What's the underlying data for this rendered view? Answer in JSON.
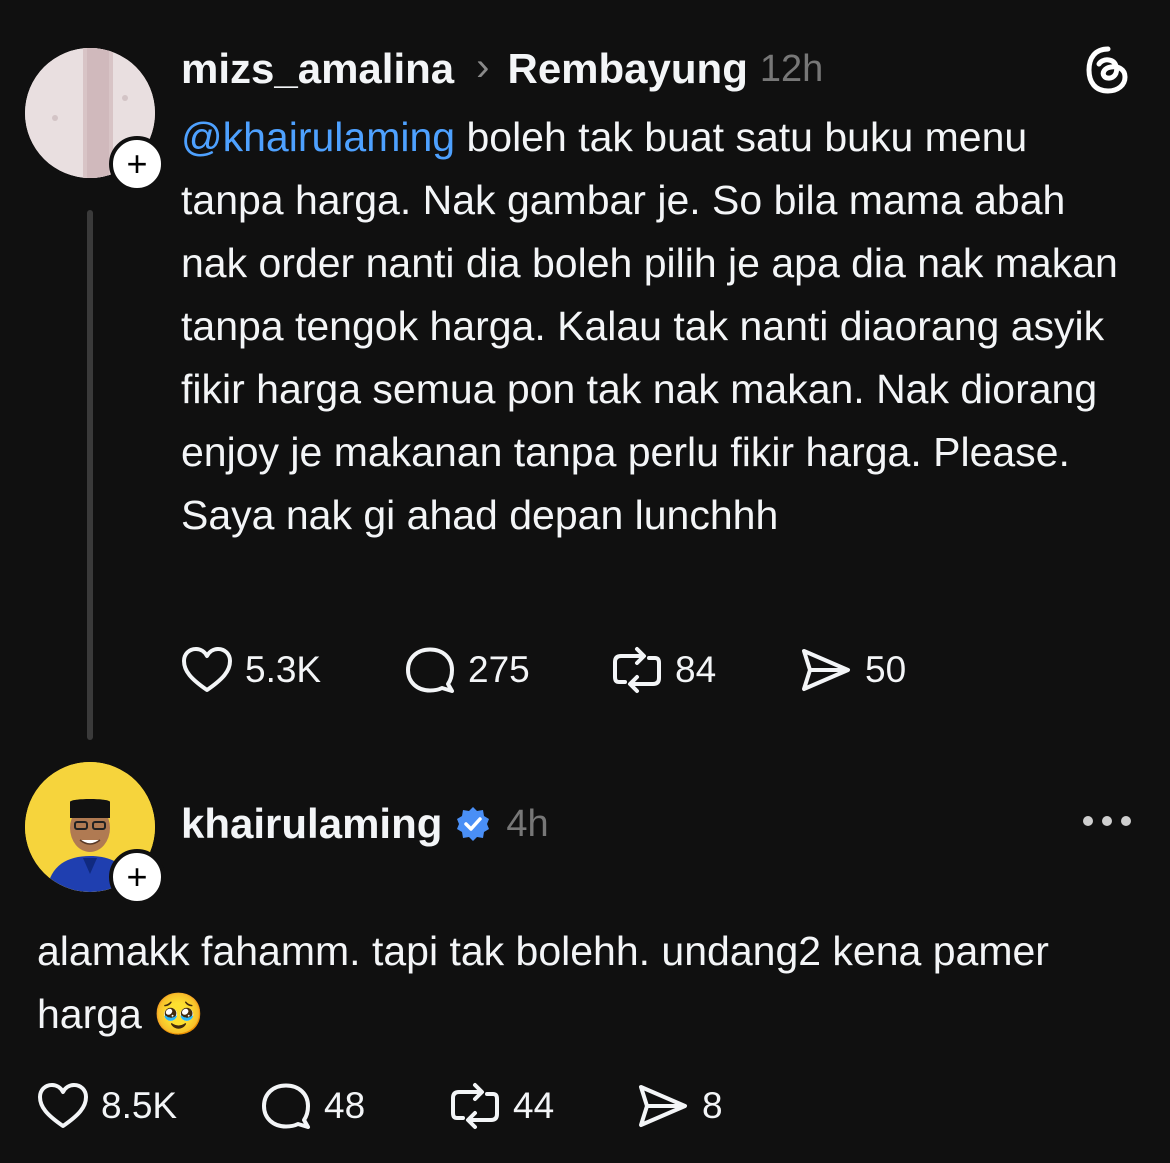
{
  "post": {
    "username": "mizs_amalina",
    "separator": "›",
    "topic": "Rembayung",
    "time": "12h",
    "mention": "@khairulaming",
    "text": " boleh tak buat satu buku menu tanpa harga. Nak gambar je. So bila mama abah nak order nanti dia boleh pilih je apa dia nak makan tanpa tengok harga. Kalau tak nanti diaorang asyik fikir harga semua pon tak nak makan. Nak diorang enjoy je makanan tanpa perlu fikir harga. Please. Saya nak gi ahad depan lunchhh",
    "likes": "5.3K",
    "comments": "275",
    "reposts": "84",
    "shares": "50"
  },
  "reply": {
    "username": "khairulaming",
    "time": "4h",
    "text": "alamakk fahamm. tapi tak bolehh. undang2 kena pamer harga",
    "emoji": "🥹",
    "likes": "8.5K",
    "comments": "48",
    "reposts": "44",
    "shares": "8"
  },
  "colors": {
    "background": "#101010",
    "mention": "#4ea1ff",
    "verified": "#4a8ff6",
    "avatar_reply_bg": "#f6d43c"
  },
  "icons": [
    "threads-logo-icon",
    "plus-icon",
    "verified-badge-icon",
    "more-icon",
    "heart-icon",
    "comment-icon",
    "repost-icon",
    "share-icon"
  ]
}
